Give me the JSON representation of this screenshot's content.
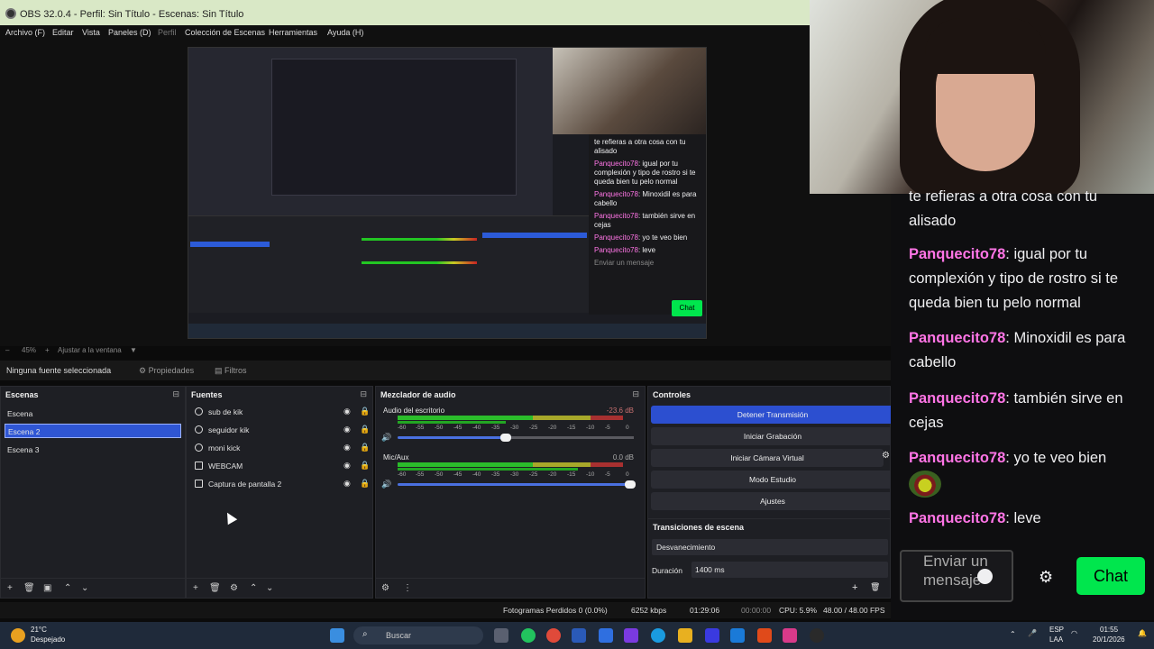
{
  "window": {
    "title": "OBS 32.0.4 - Perfil: Sin Título - Escenas: Sin Título"
  },
  "menu": [
    {
      "label": "Archivo (F)",
      "enabled": true
    },
    {
      "label": "Editar",
      "enabled": true
    },
    {
      "label": "Vista",
      "enabled": true
    },
    {
      "label": "Paneles (D)",
      "enabled": true
    },
    {
      "label": "Perfil",
      "enabled": false
    },
    {
      "label": "Colección de Escenas",
      "enabled": true
    },
    {
      "label": "Herramientas",
      "enabled": true
    },
    {
      "label": "Ayuda (H)",
      "enabled": true
    }
  ],
  "preview": {
    "chat": [
      {
        "text": "te refieras a otra cosa con tu alisado"
      },
      {
        "user": "Panquecito78",
        "text": "igual por tu complexión y tipo de rostro si te queda bien tu pelo normal"
      },
      {
        "user": "Panquecito78",
        "text": "Minoxidil es para cabello"
      },
      {
        "user": "Panquecito78",
        "text": "también sirve en cejas"
      },
      {
        "user": "Panquecito78",
        "text": "yo te veo bien"
      },
      {
        "user": "Panquecito78",
        "text": "leve"
      }
    ],
    "chat_input": "Enviar un mensaje",
    "chat_button": "Chat"
  },
  "zoom": {
    "value": "45%",
    "fit_label": "Ajustar a la ventana"
  },
  "source_toolbar": {
    "no_source": "Ninguna fuente seleccionada",
    "properties": "Propiedades",
    "filters": "Filtros"
  },
  "scenes": {
    "title": "Escenas",
    "items": [
      "Escena",
      "Escena 2",
      "Escena 3"
    ],
    "selected_index": 1
  },
  "sources": {
    "title": "Fuentes",
    "items": [
      {
        "name": "sub de kik",
        "icon": "globe-icon"
      },
      {
        "name": "seguidor kik",
        "icon": "globe-icon"
      },
      {
        "name": "moni kick",
        "icon": "globe-icon"
      },
      {
        "name": "WEBCAM",
        "icon": "camera-icon"
      },
      {
        "name": "Captura de pantalla 2",
        "icon": "monitor-icon"
      }
    ]
  },
  "mixer": {
    "title": "Mezclador de audio",
    "ticks": [
      "-60",
      "-55",
      "-50",
      "-45",
      "-40",
      "-35",
      "-30",
      "-25",
      "-20",
      "-15",
      "-10",
      "-5",
      "0"
    ],
    "channels": [
      {
        "name": "Audio del escritorio",
        "db": "-23.6 dB",
        "volume": 0.5
      },
      {
        "name": "Mic/Aux",
        "db": "0.0 dB",
        "volume": 1.0
      }
    ]
  },
  "controls": {
    "title": "Controles",
    "buttons": [
      "Detener Transmisión",
      "Iniciar Grabación",
      "Iniciar Cámara Virtual",
      "Modo Estudio",
      "Ajustes"
    ]
  },
  "transitions": {
    "title": "Transiciones de escena",
    "type": "Desvanecimiento",
    "duration_label": "Duración",
    "duration_value": "1400 ms"
  },
  "status": {
    "dropped": "Fotogramas Perdidos 0 (0.0%)",
    "bitrate": "6252 kbps",
    "stream_time": "01:29:06",
    "rec_time": "00:00:00",
    "cpu": "CPU: 5.9%",
    "fps": "48.00 / 48.00 FPS"
  },
  "chat": {
    "messages": [
      {
        "user": "",
        "text": "te refieras a otra cosa con tu alisado"
      },
      {
        "user": "Panquecito78",
        "text": "igual por tu complexión y tipo de rostro si te queda bien tu pelo normal"
      },
      {
        "user": "Panquecito78",
        "text": "Minoxidil es para cabello"
      },
      {
        "user": "Panquecito78",
        "text": "también sirve en cejas"
      },
      {
        "user": "Panquecito78",
        "text": "yo te veo bien",
        "emote": true
      },
      {
        "user": "Panquecito78",
        "text": "leve"
      }
    ],
    "input_placeholder": "Enviar un mensaje",
    "send_label": "Chat",
    "user_color": "#ff75e6",
    "send_color": "#00e64d"
  },
  "taskbar": {
    "weather_temp": "21°C",
    "weather_desc": "Despejado",
    "search": "Buscar",
    "lang": "ESP",
    "layout": "LAA",
    "time": "01:55",
    "date": "20/1/2026"
  }
}
